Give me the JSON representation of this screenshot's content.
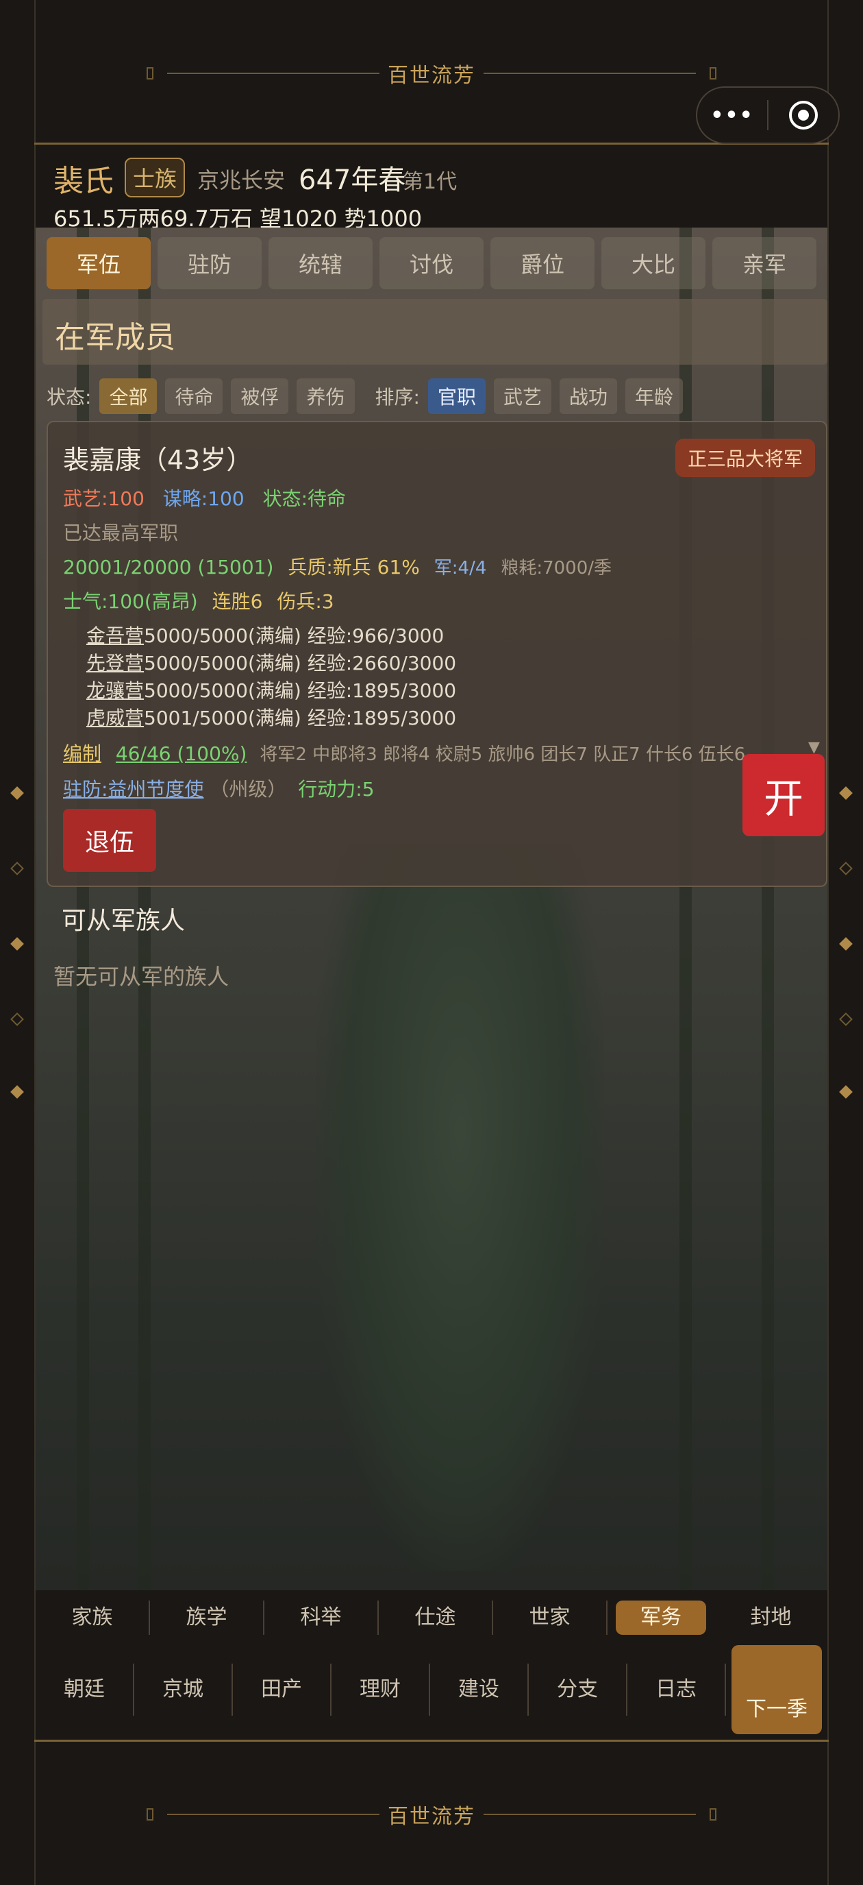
{
  "banner": {
    "title": "百世流芳"
  },
  "capsule": {
    "more": "•••"
  },
  "header": {
    "clan_name": "裴氏",
    "clan_tag": "士族",
    "location": "京兆长安",
    "year": "647年春",
    "generation": "第1代",
    "resources": "651.5万两69.7万石  望1020 势1000"
  },
  "tabs": [
    "军伍",
    "驻防",
    "统辖",
    "讨伐",
    "爵位",
    "大比",
    "亲军"
  ],
  "section": {
    "title": "在军成员"
  },
  "filters": {
    "status_label": "状态:",
    "status_options": [
      "全部",
      "待命",
      "被俘",
      "养伤"
    ],
    "sort_label": "排序:",
    "sort_options": [
      "官职",
      "武艺",
      "战功",
      "年龄"
    ]
  },
  "member": {
    "name": "裴嘉康（43岁）",
    "rank": "正三品大将军",
    "martial": "武艺:100",
    "strategy": "谋略:100",
    "status": "状态:待命",
    "note": "已达最高军职",
    "troops": "20001/20000 (15001)",
    "quality": "兵质:新兵 61%",
    "army": "军:4/4",
    "grain": "粮耗:7000/季",
    "morale": "士气:100(高昂)",
    "streak": "连胜6",
    "wounded": "伤兵:3",
    "units": [
      {
        "name": "金吾营",
        "info": "5000/5000(满编) 经验:966/3000"
      },
      {
        "name": "先登营",
        "info": "5000/5000(满编) 经验:2660/3000"
      },
      {
        "name": "龙骧营",
        "info": "5000/5000(满编) 经验:1895/3000"
      },
      {
        "name": "虎威营",
        "info": "5001/5000(满编) 经验:1895/3000"
      }
    ],
    "org_label": "编制",
    "org_value": "46/46 (100%)",
    "org_detail": "将军2 中郎将3 郎将4 校尉5 旅帅6 团长7 队正7 什长6 伍长6",
    "garrison": "驻防:益州节度使",
    "garrison_level": "（州级）",
    "action": "行动力:5",
    "retire_label": "退伍"
  },
  "open_label": "开",
  "recruit": {
    "title": "可从军族人",
    "empty": "暂无可从军的族人"
  },
  "nav_top": [
    "家族",
    "族学",
    "科举",
    "仕途",
    "世家",
    "军务",
    "封地"
  ],
  "nav_top_active": "军务",
  "nav_bottom": [
    "朝廷",
    "京城",
    "田产",
    "理财",
    "建设",
    "分支",
    "日志"
  ],
  "next_label": "下一季",
  "colors": {
    "accent": "#9b682a",
    "danger": "#cc2a2e",
    "gold": "#c9a35a"
  }
}
